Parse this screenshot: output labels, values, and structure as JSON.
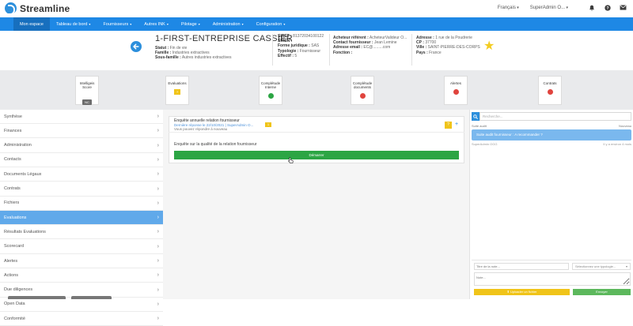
{
  "app": {
    "name": "Streamline"
  },
  "topbar": {
    "language": "Français",
    "user": "SuperAdmin O...",
    "icons": [
      "bell-icon",
      "help-icon",
      "mail-icon"
    ]
  },
  "nav": [
    {
      "label": "Mon espace",
      "active": true,
      "caret": false
    },
    {
      "label": "Tableau de bord",
      "caret": true
    },
    {
      "label": "Fournisseurs",
      "caret": true
    },
    {
      "label": "Autres INK",
      "caret": true
    },
    {
      "label": "Pilotage",
      "caret": true
    },
    {
      "label": "Administration",
      "caret": true
    },
    {
      "label": "Configuration",
      "caret": true
    }
  ],
  "supplier": {
    "name": "1-FIRST-ENTREPRISE CASSIER",
    "col1": [
      {
        "k": "Statut :",
        "v": "Fin de vie"
      },
      {
        "k": "Famille :",
        "v": "Industries extractives"
      },
      {
        "k": "Sous-famille :",
        "v": "Autres industries extractives"
      }
    ],
    "col2": [
      {
        "k": "SIRET :",
        "v": "81372034100122"
      },
      {
        "k": "SIREN :",
        "v": ""
      },
      {
        "k": "Forme juridique :",
        "v": "SAS"
      },
      {
        "k": "Typologie :",
        "v": "Fournisseur"
      },
      {
        "k": "Effectif :",
        "v": "5"
      }
    ],
    "col3": [
      {
        "k": "Acheteur référent :",
        "v": "AcheteurValideur O..."
      },
      {
        "k": "Contact fournisseur :",
        "v": "Jean Lemine"
      },
      {
        "k": "Adresse email :",
        "v": "EC@.........com"
      },
      {
        "k": "Fonction :",
        "v": ""
      }
    ],
    "col4": [
      {
        "k": "Adresse :",
        "v": "1 rue de la Poudrerie"
      },
      {
        "k": "CP :",
        "v": "37700"
      },
      {
        "k": "Ville :",
        "v": "SAINT-PIERRE-DES-CORPS"
      },
      {
        "k": "Pays :",
        "v": "France"
      }
    ]
  },
  "kpis": [
    {
      "label": "Intelligeis Score",
      "indicator": "badge",
      "value": "NC"
    },
    {
      "label": "Evaluations",
      "indicator": "square",
      "color": "#f0c419",
      "value": "?"
    },
    {
      "label": "Complétude Interne",
      "indicator": "dot",
      "color": "#2ca544"
    },
    {
      "label": "Complétude documents",
      "indicator": "dot",
      "color": "#e0443e"
    },
    {
      "label": "Alertes",
      "indicator": "dot",
      "color": "#e0443e"
    },
    {
      "label": "Contrats",
      "indicator": "dot",
      "color": "#e0443e"
    }
  ],
  "sidebar": [
    {
      "label": "Synthèse"
    },
    {
      "label": "Finances"
    },
    {
      "label": "Administration"
    },
    {
      "label": "Contacts"
    },
    {
      "label": "Documents Légaux"
    },
    {
      "label": "Contrats"
    },
    {
      "label": "Fichiers"
    },
    {
      "label": "Evaluations",
      "active": true
    },
    {
      "label": "Résultats Evaluations"
    },
    {
      "label": "Scorecard"
    },
    {
      "label": "Alertes"
    },
    {
      "label": "Actions"
    },
    {
      "label": "Due diligences"
    },
    {
      "label": "Open Data"
    },
    {
      "label": "Conformité"
    }
  ],
  "survey": {
    "title": "Enquête annuelle relation fournisseur",
    "meta": "Dernière réponse le 22/10/2021 | SuperAdmin O...",
    "sub": "Vous pouvez répondre à nouveau",
    "badge": "1",
    "action_badge": "?",
    "plus": "+",
    "question": "Enquête sur la qualité de la relation fournisseur",
    "start_label": "Démarrer"
  },
  "activity": {
    "search_placeholder": "Recherche...",
    "head_left": "Suite audit",
    "head_right": "Nouveau",
    "message": "Suite audit fournisseur : A recommander ?",
    "foot_left": "SuperAdmin OGG",
    "foot_right": "Il y a environ 4 mois",
    "note_title_placeholder": "Titre de la note...",
    "note_type": "Sélectionnez une typologie...",
    "note_body_placeholder": "Note...",
    "upload_label": "Uploader un fichier",
    "send_label": "Envoyer"
  }
}
